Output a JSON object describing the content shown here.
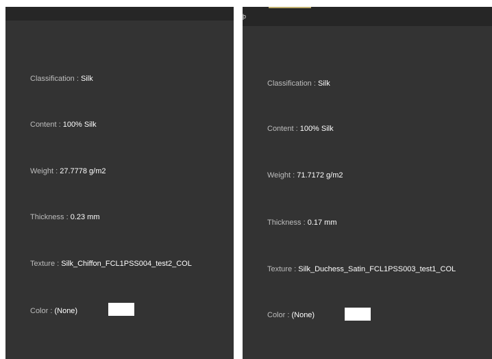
{
  "panels": [
    {
      "title_glyph": "",
      "classification": {
        "label": "Classification : ",
        "value": "Silk"
      },
      "content": {
        "label": "Content : ",
        "value": "100% Silk"
      },
      "weight": {
        "label": "Weight : ",
        "value": "27.7778 g/m2"
      },
      "thickness": {
        "label": "Thickness : ",
        "value": "0.23 mm"
      },
      "texture": {
        "label": "Texture : ",
        "value": "Silk_Chiffon_FCL1PSS004_test2_COL"
      },
      "color": {
        "label": "Color : ",
        "value": "(None)",
        "swatch": "#ffffff"
      }
    },
    {
      "title_glyph": "þ",
      "classification": {
        "label": "Classification : ",
        "value": "Silk"
      },
      "content": {
        "label": "Content : ",
        "value": "100% Silk"
      },
      "weight": {
        "label": "Weight : ",
        "value": "71.7172 g/m2"
      },
      "thickness": {
        "label": "Thickness : ",
        "value": "0.17 mm"
      },
      "texture": {
        "label": "Texture : ",
        "value": "Silk_Duchess_Satin_FCL1PSS003_test1_COL"
      },
      "color": {
        "label": "Color : ",
        "value": "(None)",
        "swatch": "#ffffff"
      }
    }
  ],
  "colors": {
    "panel_bg": "#333333",
    "titlebar_bg": "#262626",
    "label_text": "#bdbdbd",
    "value_text": "#ffffff",
    "accent": "#bfae6e"
  }
}
